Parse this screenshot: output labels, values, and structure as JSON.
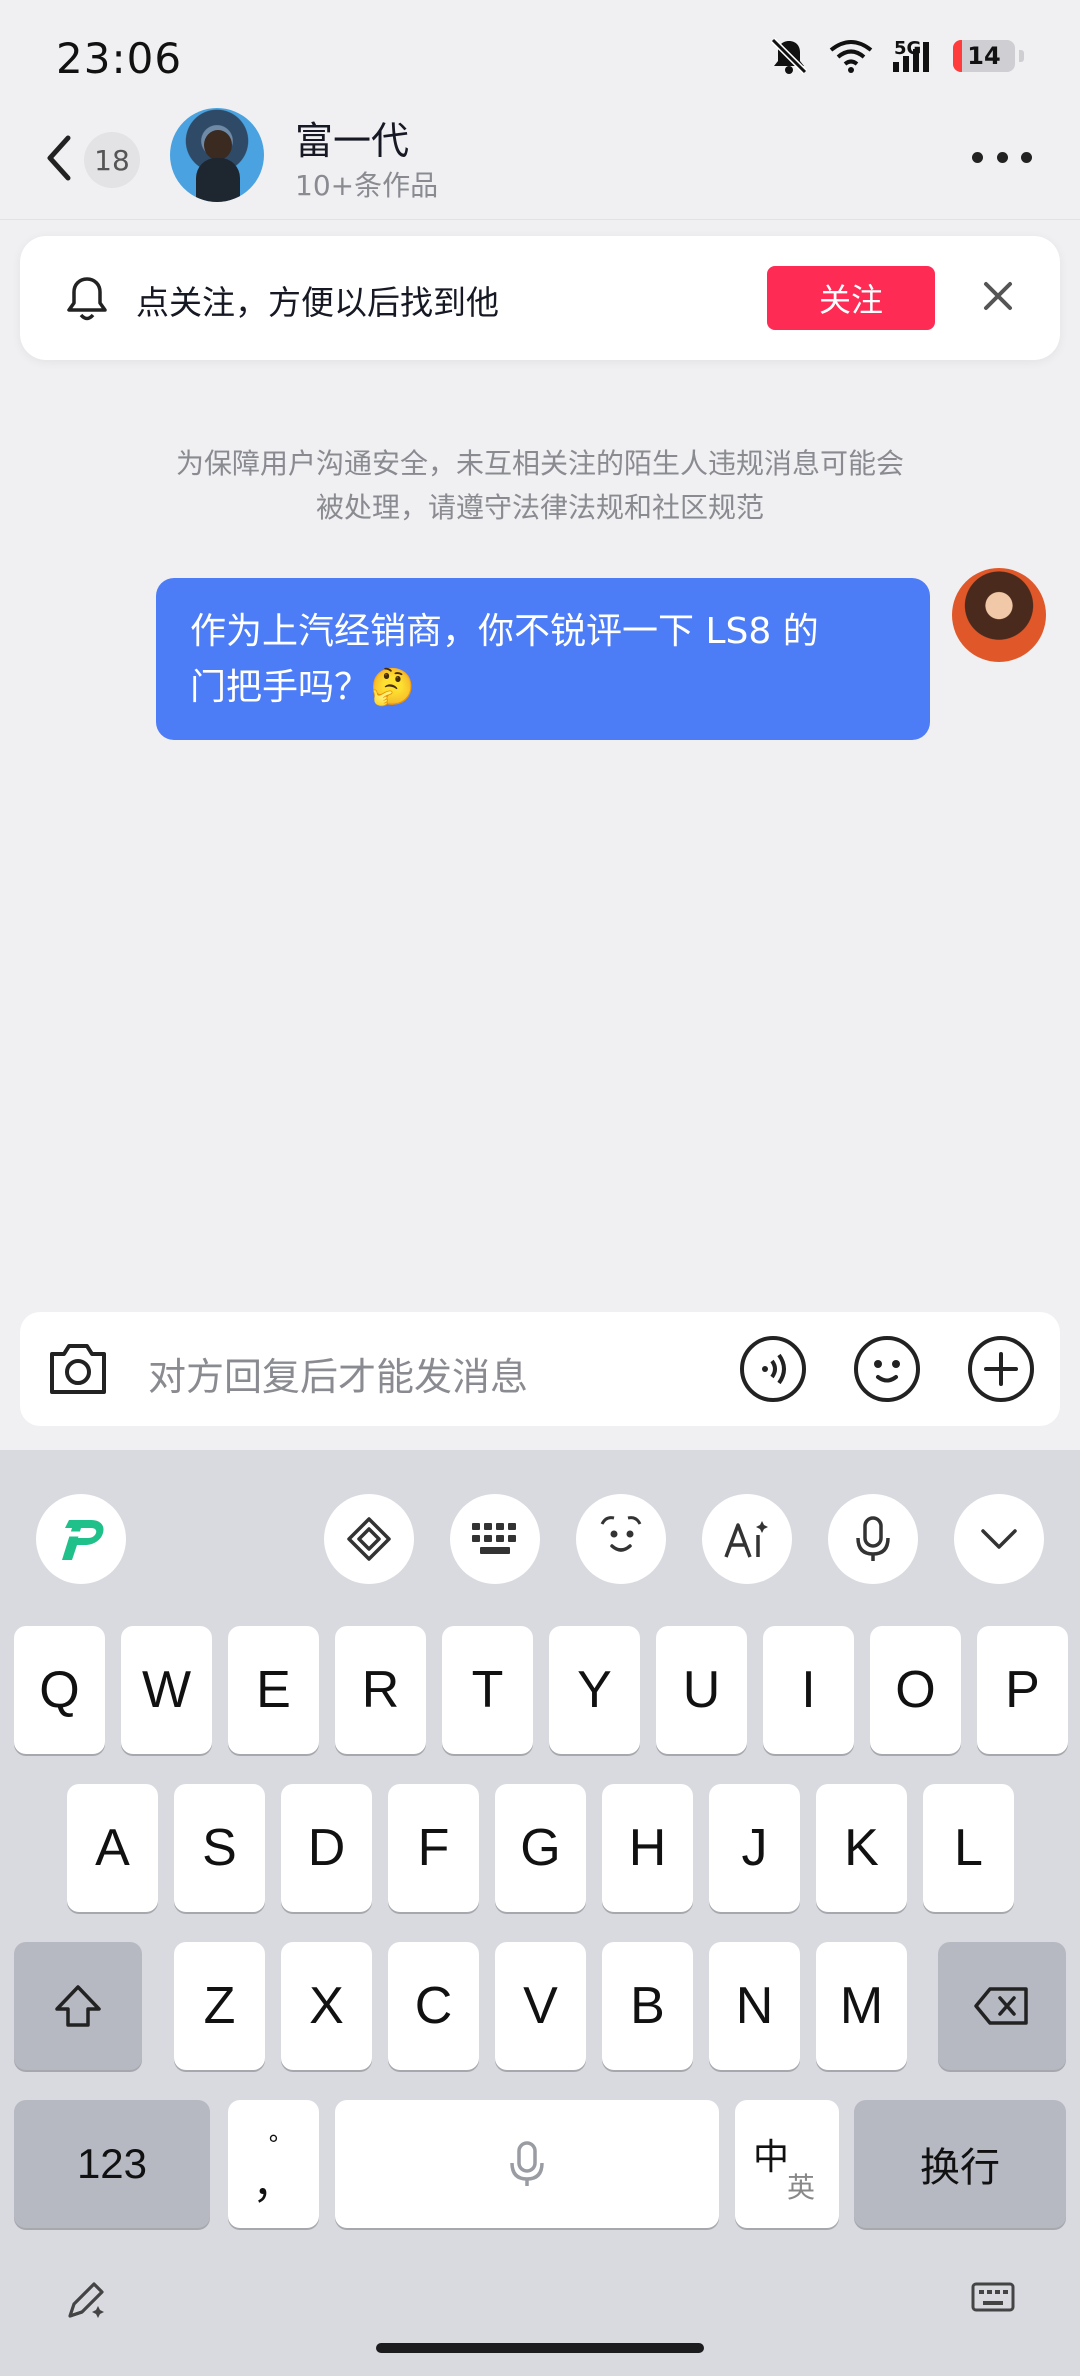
{
  "status_bar": {
    "time": "23:06",
    "network": "5G",
    "battery_level": "14",
    "battery_fraction": 0.14
  },
  "header": {
    "back_count": "18",
    "title": "富一代",
    "subtitle": "10+条作品"
  },
  "follow_banner": {
    "text": "点关注，方便以后找到他",
    "button_label": "关注"
  },
  "notice": {
    "line1": "为保障用户沟通安全，未互相关注的陌生人违规消息可能会",
    "line2": "被处理，请遵守法律法规和社区规范"
  },
  "messages": [
    {
      "line1": "作为上汽经销商，你不锐评一下 LS8 的",
      "line2": "门把手吗？🤔"
    }
  ],
  "input": {
    "placeholder": "对方回复后才能发消息"
  },
  "keyboard": {
    "row1": [
      "Q",
      "W",
      "E",
      "R",
      "T",
      "Y",
      "U",
      "I",
      "O",
      "P"
    ],
    "row2": [
      "A",
      "S",
      "D",
      "F",
      "G",
      "H",
      "J",
      "K",
      "L"
    ],
    "row3": [
      "Z",
      "X",
      "C",
      "V",
      "B",
      "N",
      "M"
    ],
    "numbers_key": "123",
    "punct_top": "°",
    "punct_main": "，",
    "lang_zh": "中",
    "lang_en": "英",
    "enter_key": "换行"
  },
  "colors": {
    "accent_red": "#fe2c55",
    "bubble_blue": "#4d7cf7",
    "brand_green": "#20c08a"
  }
}
